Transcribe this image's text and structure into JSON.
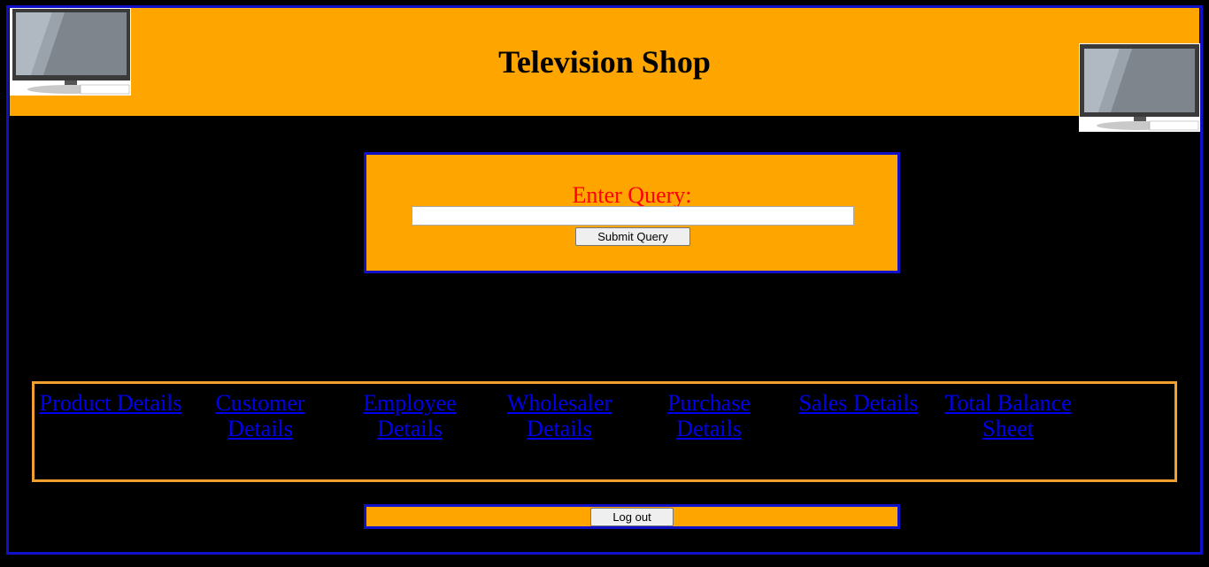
{
  "header": {
    "title": "Television Shop"
  },
  "images": {
    "left_tv": "television-icon",
    "right_tv": "television-icon"
  },
  "query": {
    "label": "Enter Query:",
    "input_value": "",
    "submit_label": "Submit Query"
  },
  "nav": {
    "items": [
      {
        "label": "Product Details"
      },
      {
        "label": "Customer Details"
      },
      {
        "label": "Employee Details"
      },
      {
        "label": "Wholesaler Details"
      },
      {
        "label": "Purchase Details"
      },
      {
        "label": "Sales Details"
      },
      {
        "label": "Total Balance Sheet"
      }
    ]
  },
  "footer": {
    "logout_label": "Log out"
  },
  "colors": {
    "header_bg": "#ffa500",
    "frame_border": "#1010c8",
    "nav_border": "#f0a030",
    "query_label": "#ff0000",
    "link": "#0000ee",
    "page_bg": "#000000"
  }
}
